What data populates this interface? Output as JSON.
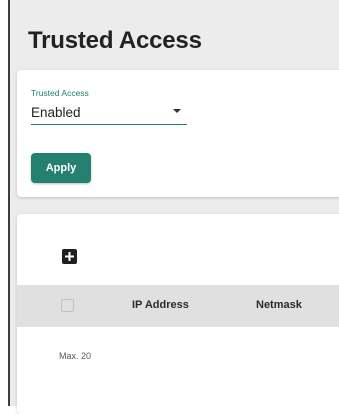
{
  "page": {
    "title": "Trusted Access"
  },
  "settings": {
    "field_label": "Trusted Access",
    "selected_value": "Enabled",
    "apply_label": "Apply"
  },
  "table": {
    "columns": [
      "IP Address",
      "Netmask"
    ],
    "max_note": "Max. 20"
  },
  "colors": {
    "accent": "#1a7f73",
    "button": "#25806f",
    "header_bg": "#e0e0e0",
    "page_bg": "#ececec"
  },
  "icons": {
    "add": "plus-square-icon",
    "dropdown": "caret-down-icon"
  }
}
